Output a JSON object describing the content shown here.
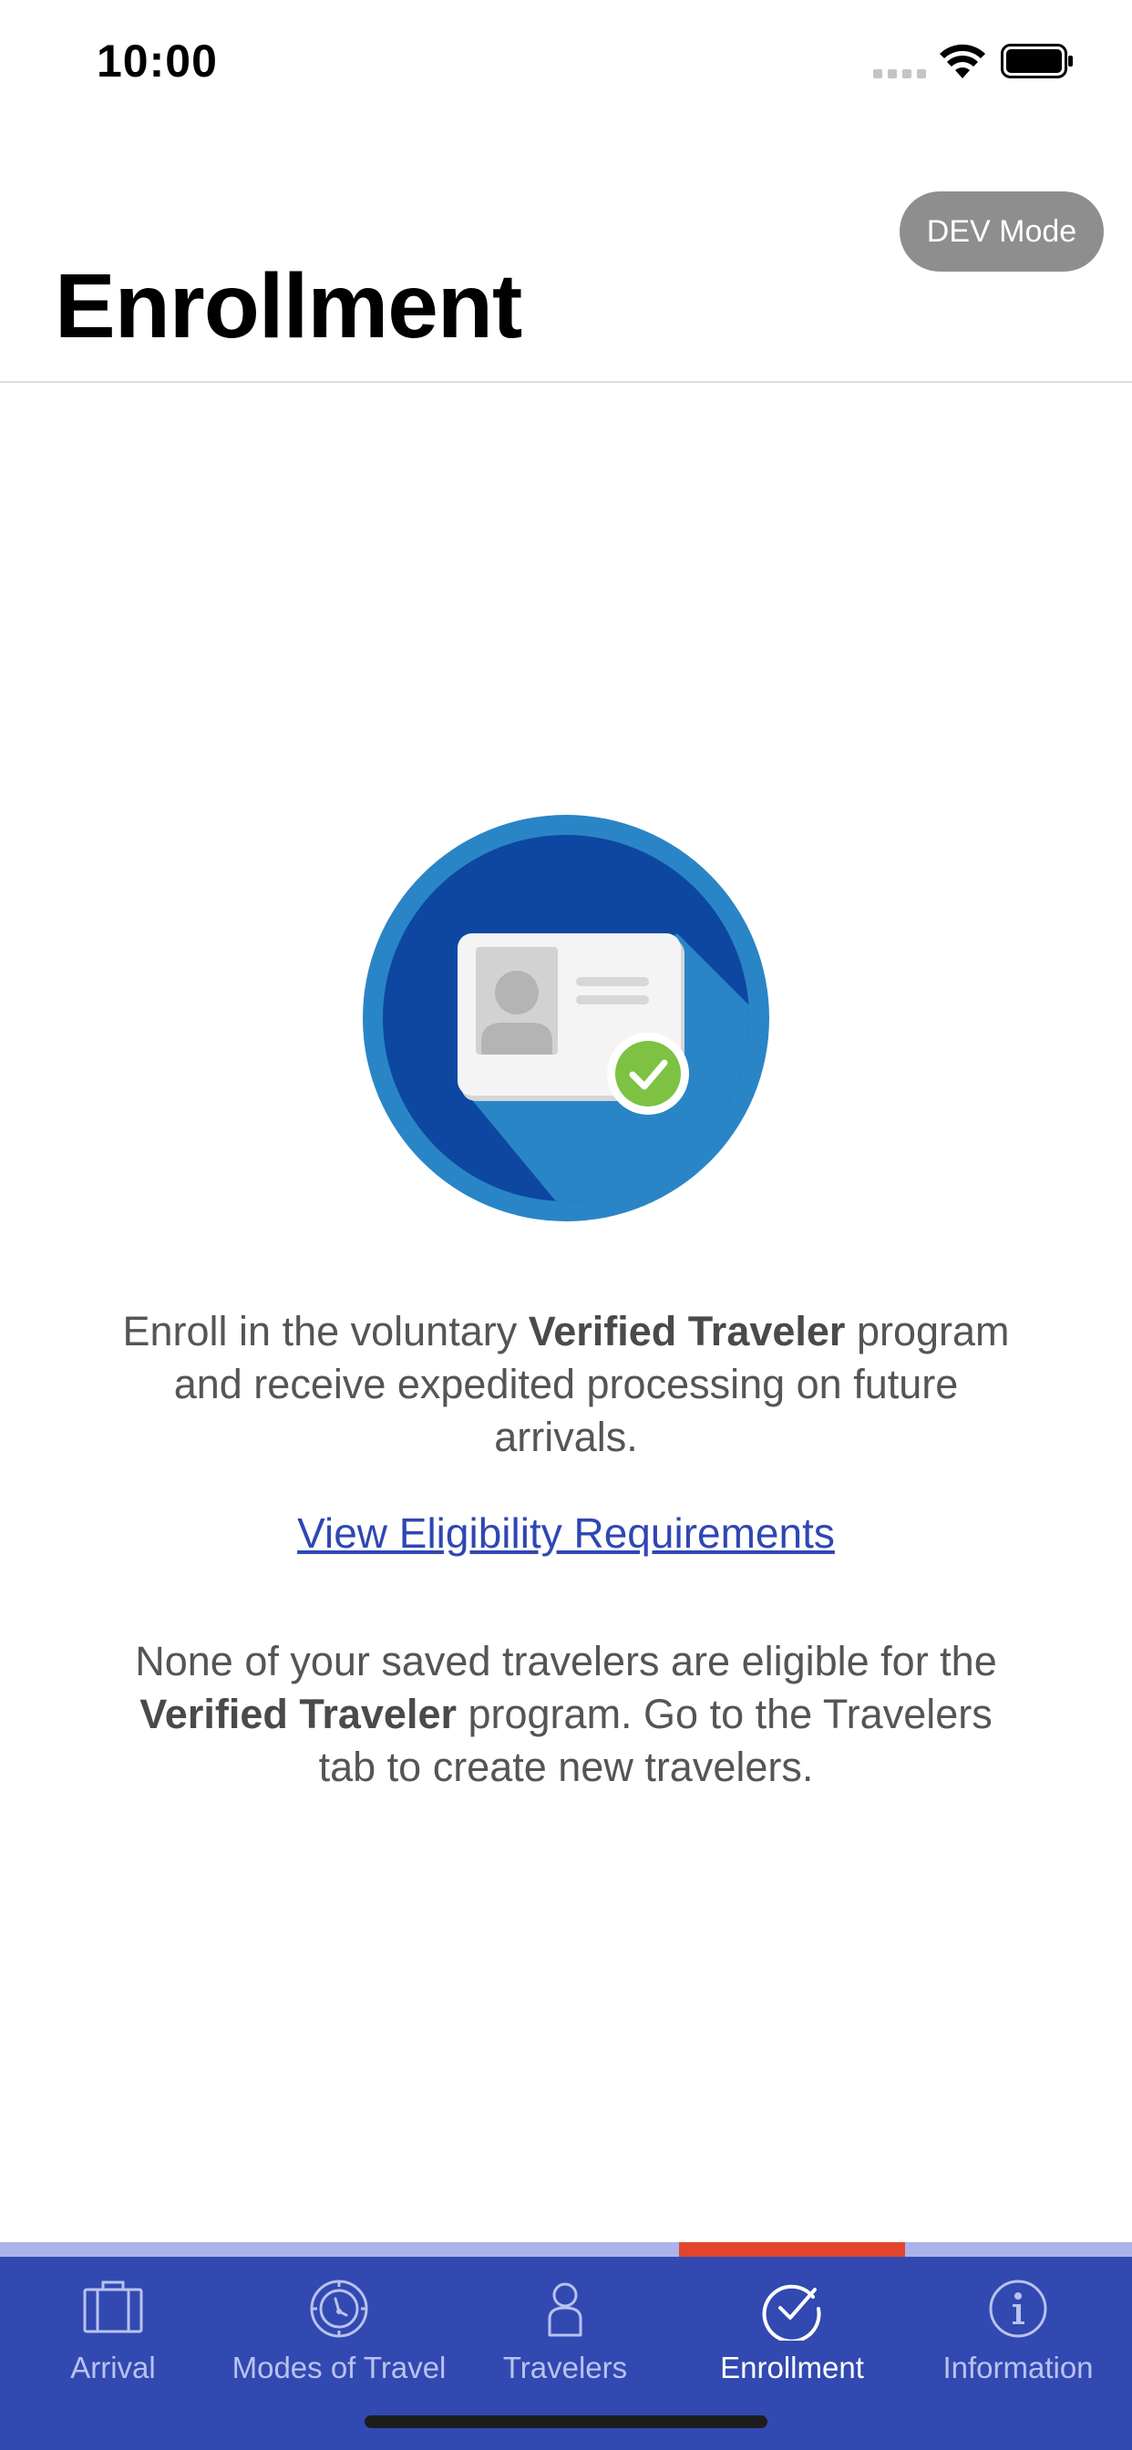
{
  "status_bar": {
    "time": "10:00",
    "icons": [
      "signal-icon",
      "wifi-icon",
      "battery-icon"
    ]
  },
  "header": {
    "dev_mode_label": "DEV Mode",
    "title": "Enrollment"
  },
  "illustration": {
    "icon": "id-card-verified-icon",
    "colors": {
      "outer_ring": "#2a85c6",
      "inner_circle": "#0d47a1",
      "check": "#7dc242"
    }
  },
  "content": {
    "intro_prefix": "Enroll in the voluntary ",
    "intro_bold": "Verified Traveler",
    "intro_suffix": " program and receive expedited processing on future arrivals.",
    "eligibility_link": "View Eligibility Requirements",
    "notice_prefix": "None of your saved travelers are eligible for the ",
    "notice_bold": "Verified Traveler",
    "notice_suffix": " program. Go to the Travelers tab to create new travelers."
  },
  "tab_bar": {
    "active_index": 3,
    "colors": {
      "background": "#3249b2",
      "accent": "#aab4ea",
      "active_accent": "#e2442e"
    },
    "tabs": [
      {
        "label": "Arrival",
        "icon": "suitcase-icon"
      },
      {
        "label": "Modes of Travel",
        "icon": "compass-icon"
      },
      {
        "label": "Travelers",
        "icon": "person-icon"
      },
      {
        "label": "Enrollment",
        "icon": "check-circle-icon"
      },
      {
        "label": "Information",
        "icon": "info-icon"
      }
    ]
  }
}
